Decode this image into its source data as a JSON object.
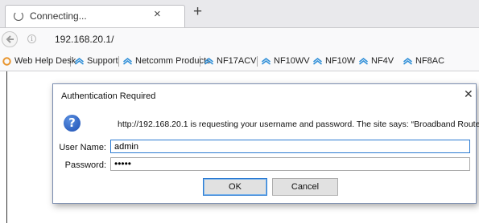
{
  "tab": {
    "title": "Connecting...",
    "close_label": "×",
    "new_tab_label": "+"
  },
  "nav": {
    "url": "192.168.20.1/",
    "info_label": "i"
  },
  "bookmarks": [
    {
      "label": "Web Help Desk",
      "icon": "web-help-desk-icon",
      "color": "#e8952e"
    },
    {
      "label": "Support",
      "icon": "netcomm-icon",
      "color": "#2f8fd8"
    },
    {
      "label": "Netcomm Products",
      "icon": "netcomm-icon",
      "color": "#2f8fd8"
    },
    {
      "label": "NF17ACV",
      "icon": "netcomm-icon",
      "color": "#2f8fd8"
    },
    {
      "label": "NF10WV",
      "icon": "netcomm-icon",
      "color": "#2f8fd8"
    },
    {
      "label": "NF10W",
      "icon": "netcomm-icon",
      "color": "#2f8fd8"
    },
    {
      "label": "NF4V",
      "icon": "netcomm-icon",
      "color": "#2f8fd8"
    },
    {
      "label": "NF8AC",
      "icon": "netcomm-icon",
      "color": "#2f8fd8"
    }
  ],
  "dialog": {
    "title": "Authentication Required",
    "close_label": "✕",
    "help_glyph": "?",
    "message": "http://192.168.20.1 is requesting your username and password. The site says: “Broadband Router”",
    "username_label": "User Name:",
    "username_value": "admin",
    "password_label": "Password:",
    "password_value": "•••••",
    "ok_label": "OK",
    "cancel_label": "Cancel"
  }
}
